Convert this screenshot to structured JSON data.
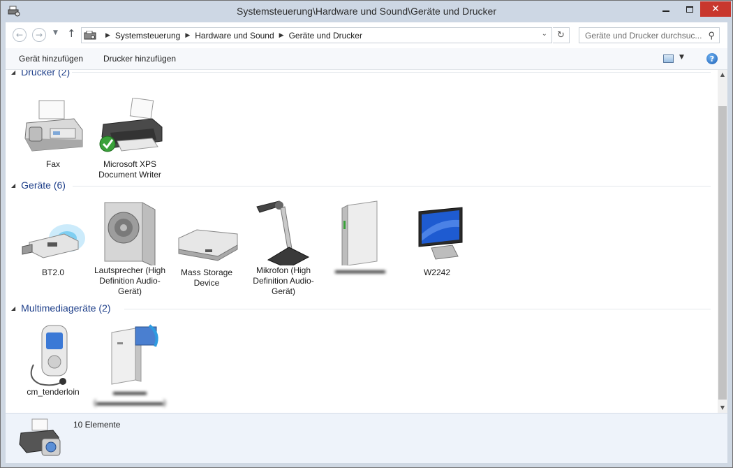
{
  "window": {
    "title": "Systemsteuerung\\Hardware und Sound\\Geräte und Drucker",
    "controls": {
      "minimize": "minimize-icon",
      "maximize": "maximize-icon",
      "close": "close-icon",
      "close_color": "#c8372d"
    }
  },
  "navigation": {
    "breadcrumbs": [
      "Systemsteuerung",
      "Hardware und Sound",
      "Geräte und Drucker"
    ],
    "search_placeholder": "Geräte und Drucker durchsuc..."
  },
  "commands": {
    "add_device": "Gerät hinzufügen",
    "add_printer": "Drucker hinzufügen"
  },
  "groups": [
    {
      "header": "Drucker (2)",
      "items": [
        {
          "label": "Fax",
          "icon": "fax-icon"
        },
        {
          "label": "Microsoft XPS Document Writer",
          "icon": "printer-icon",
          "default": true
        }
      ]
    },
    {
      "header": "Geräte (6)",
      "items": [
        {
          "label": "BT2.0",
          "icon": "bluetooth-usb-icon"
        },
        {
          "label": "Lautsprecher (High Definition Audio-Gerät)",
          "icon": "speaker-icon"
        },
        {
          "label": "Mass Storage Device",
          "icon": "hard-drive-icon"
        },
        {
          "label": "Mikrofon (High Definition Audio-Gerät)",
          "icon": "microphone-icon"
        },
        {
          "label": "",
          "icon": "external-drive-icon",
          "blurred": true
        },
        {
          "label": "W2242",
          "icon": "monitor-icon"
        }
      ]
    },
    {
      "header": "Multimediageräte (2)",
      "items": [
        {
          "label": "cm_tenderloin",
          "icon": "media-player-icon"
        },
        {
          "label": "",
          "icon": "media-server-icon",
          "blurred": true
        }
      ]
    }
  ],
  "details": {
    "count": "10 Elemente",
    "icon": "devices-printers-icon"
  },
  "colors": {
    "group_header": "#1e3f8a",
    "default_badge": "#3aa13a"
  }
}
